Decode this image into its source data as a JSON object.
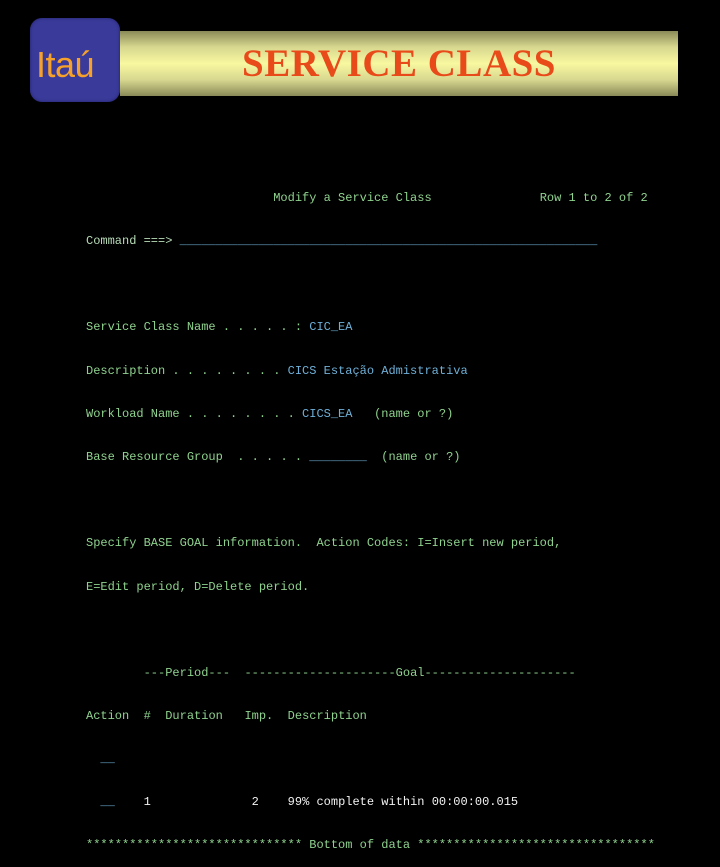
{
  "logo": {
    "text": "Itaú",
    "bg": "#3a3a9a",
    "fg": "#f5a12a"
  },
  "banner": {
    "title": "SERVICE CLASS",
    "title_color": "#e84a1a"
  },
  "terminal": {
    "panel_title": "Modify a Service Class",
    "row_info": "Row 1 to 2 of 2",
    "command_label": "Command ===>",
    "command_value": "",
    "fields": [
      {
        "label": "Service Class Name",
        "dots": " . . . . . :",
        "value": "CIC_EA",
        "hint": ""
      },
      {
        "label": "Description",
        "dots": " . . . . . . . .",
        "value": "CICS Estação Admistrativa",
        "hint": ""
      },
      {
        "label": "Workload Name",
        "dots": " . . . . . . . .",
        "value": "CICS_EA",
        "hint": "(name or ?)"
      },
      {
        "label": "Base Resource Group",
        "dots": " . . . . .",
        "value": "________",
        "hint": "(name or ?)"
      }
    ],
    "instructions": [
      "Specify BASE GOAL information.  Action Codes: I=Insert new period,",
      "E=Edit period, D=Delete period."
    ],
    "table": {
      "period_header": "---Period---",
      "goal_header": "---------------------Goal---------------------",
      "col_action": "Action",
      "col_num": "#",
      "col_duration": "Duration",
      "col_imp": "Imp.",
      "col_desc": "Description",
      "rows": [
        {
          "action": "__",
          "num": "",
          "duration": "",
          "imp": "",
          "description": ""
        },
        {
          "action": "__",
          "num": "1",
          "duration": "",
          "imp": "2",
          "description": "99% complete within 00:00:00.015"
        }
      ]
    },
    "bottom_line": "****************************** Bottom of data *********************************"
  }
}
